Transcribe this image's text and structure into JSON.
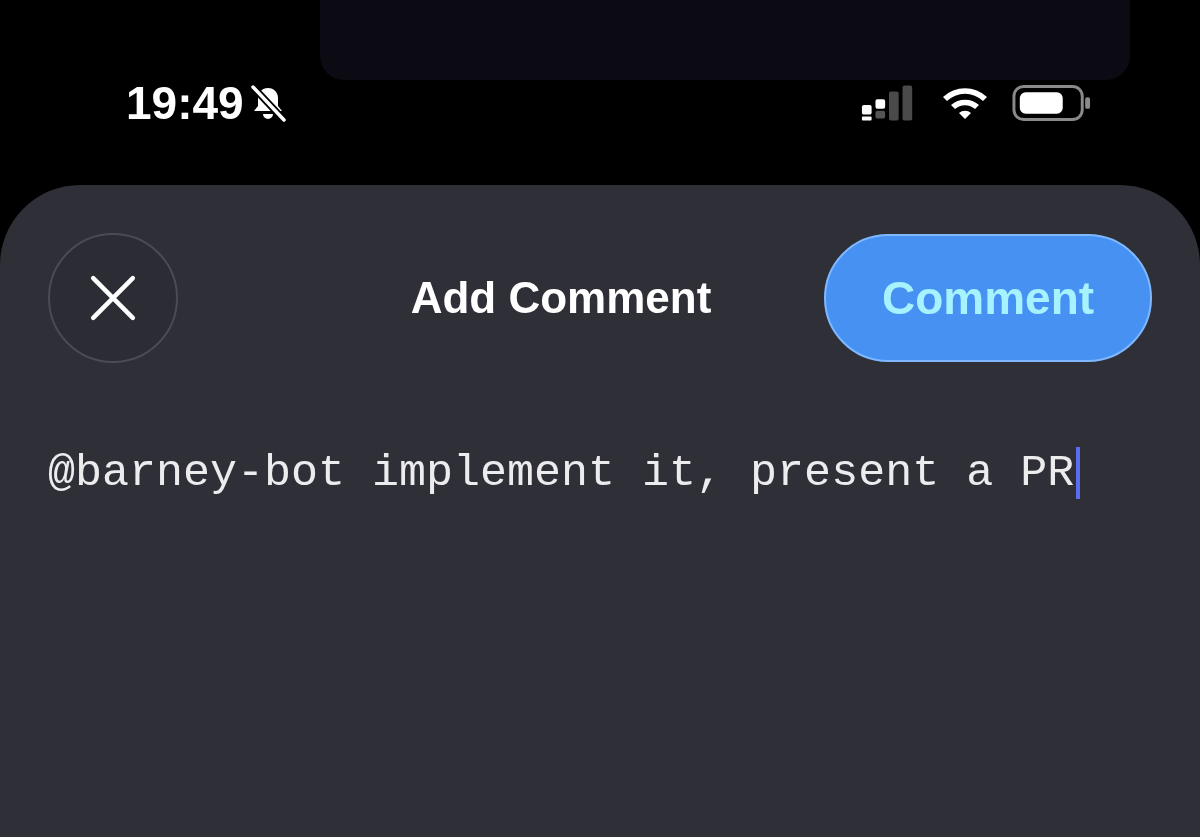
{
  "status_bar": {
    "time": "19:49"
  },
  "sheet": {
    "title": "Add Comment",
    "submit_button": "Comment"
  },
  "comment_field": {
    "value": "@barney-bot implement it, present a PR"
  }
}
